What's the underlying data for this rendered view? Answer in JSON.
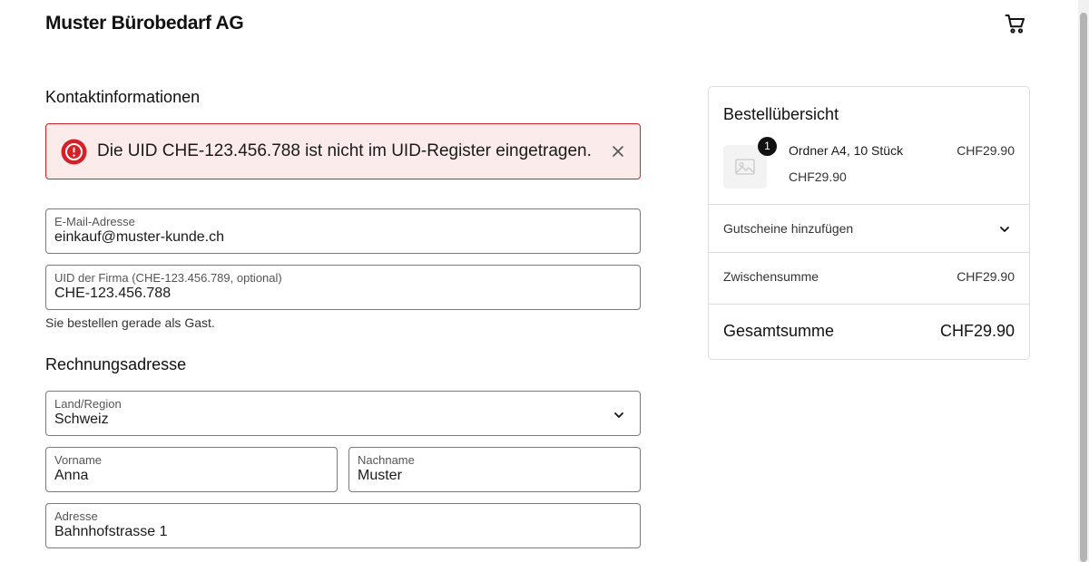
{
  "header": {
    "brand": "Muster Bürobedarf AG",
    "cart_icon": "cart-icon"
  },
  "contact": {
    "heading": "Kontaktinformationen",
    "alert": {
      "text": "Die UID CHE-123.456.788 ist nicht im UID-Register eingetragen.",
      "icon": "error-icon",
      "close_icon": "close-icon",
      "color": "#d61f26"
    },
    "email": {
      "label": "E-Mail-Adresse",
      "value": "einkauf@muster-kunde.ch"
    },
    "uid": {
      "label": "UID der Firma (CHE-123.456.789, optional)",
      "value": "CHE-123.456.788"
    },
    "guest_note": "Sie bestellen gerade als Gast."
  },
  "billing": {
    "heading": "Rechnungsadresse",
    "country": {
      "label": "Land/Region",
      "value": "Schweiz"
    },
    "first_name": {
      "label": "Vorname",
      "value": "Anna"
    },
    "last_name": {
      "label": "Nachname",
      "value": "Muster"
    },
    "address": {
      "label": "Adresse",
      "value": "Bahnhofstrasse 1"
    }
  },
  "summary": {
    "title": "Bestellübersicht",
    "item": {
      "quantity": "1",
      "name": "Ordner A4, 10 Stück",
      "price": "CHF29.90",
      "unit_price": "CHF29.90",
      "image_icon": "image-placeholder-icon"
    },
    "voucher_label": "Gutscheine hinzufügen",
    "subtotal_label": "Zwischensumme",
    "subtotal_value": "CHF29.90",
    "total_label": "Gesamtsumme",
    "total_value": "CHF29.90"
  }
}
